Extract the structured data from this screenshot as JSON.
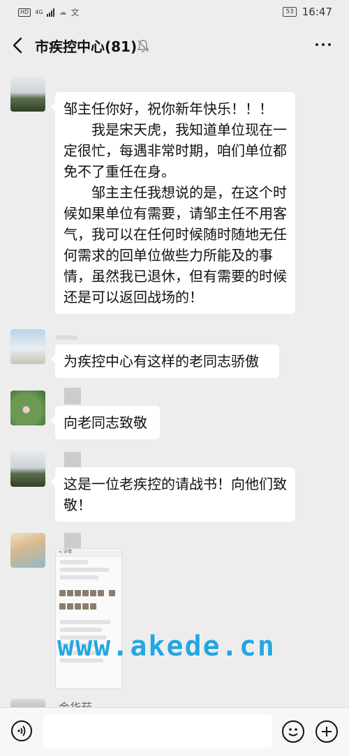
{
  "status_bar": {
    "network": "4G",
    "time": "16:47",
    "battery": "53"
  },
  "header": {
    "title": "市疾控中心(81)"
  },
  "messages": [
    {
      "paragraphs": [
        "邹主任你好，祝你新年快乐！！！",
        "我是宋天虎，我知道单位现在一定很忙，每遇非常时期，咱们单位都免不了重任在身。",
        "邹主主任我想说的是，在这个时候如果单位有需要，请邹主任不用客气，我可以在任何时候随时随地无任何需求的回单位做些力所能及的事情，虽然我已退休，但有需要的时候还是可以返回战场的！"
      ]
    },
    {
      "text": "为疾控中心有这样的老同志骄傲"
    },
    {
      "text": "向老同志致敬"
    },
    {
      "text": "这是一位老疾控的请战书！向他们致敬！"
    }
  ],
  "image_message": {
    "head": "< 详情"
  },
  "watermark": "www.akede.cn",
  "partial_sender": "金华茹",
  "input_bar": {
    "voice_icon": "voice-icon",
    "emoji_icon": "emoji-icon",
    "plus_icon": "plus-icon"
  }
}
